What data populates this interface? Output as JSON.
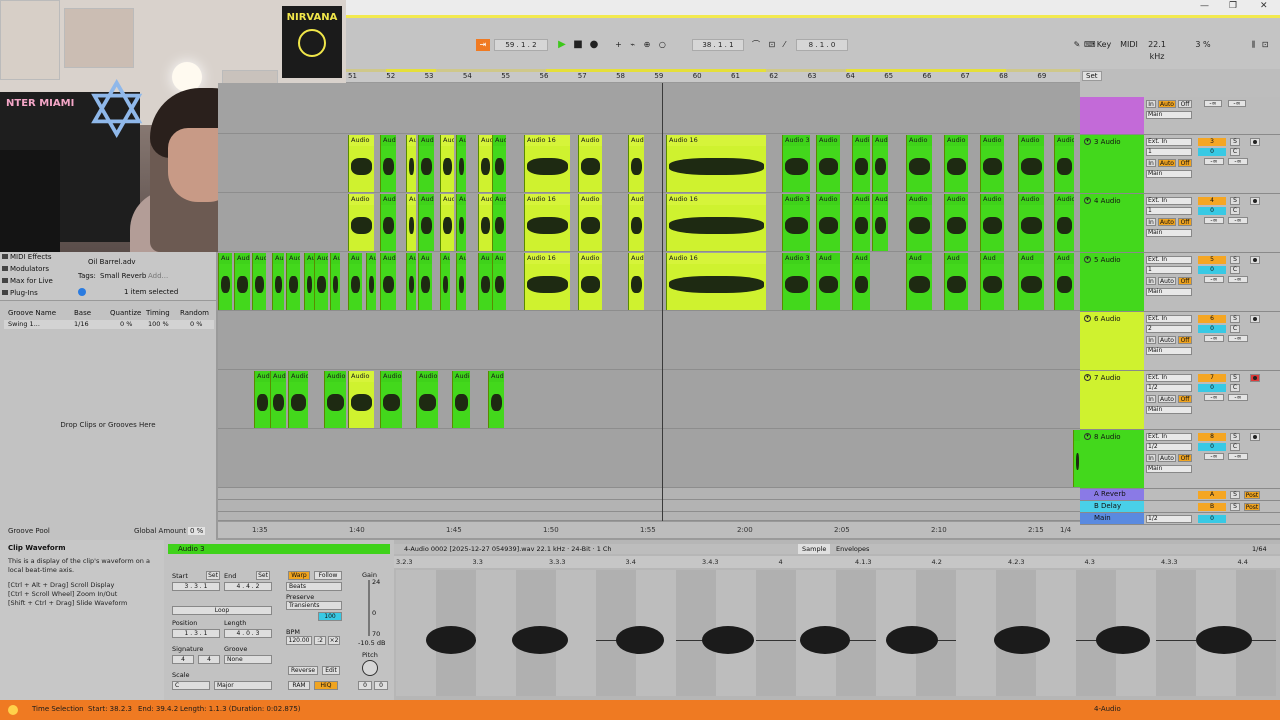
{
  "window": {
    "minimize": "—",
    "maximize": "❐",
    "close": "✕"
  },
  "transport": {
    "position": "59 . 1 . 2",
    "loop_start": "38 . 1 . 1",
    "loop_length": "8 . 1 . 0",
    "key_label": "Key",
    "midi_label": "MIDI",
    "sample_rate": "22.1 kHz",
    "cpu": "3 %"
  },
  "browser": {
    "items": [
      "MIDI Effects",
      "Modulators",
      "Max for Live",
      "Plug-Ins"
    ],
    "preset": "Oil Barrel.adv",
    "tags_label": "Tags:",
    "tag": "Small Reverb",
    "add": "Add...",
    "selection": "1 item selected"
  },
  "groove": {
    "headers": [
      "Groove Name",
      "Base",
      "Quantize",
      "Timing",
      "Random"
    ],
    "row": {
      "name": "Swing 1...",
      "base": "1/16",
      "quantize": "0 %",
      "timing": "100 %",
      "random": "0 %"
    },
    "drop_text": "Drop Clips or Grooves Here",
    "pool_label": "Groove Pool",
    "global_amount_label": "Global Amount",
    "global_amount": "0 %"
  },
  "ruler": {
    "bars": [
      "51",
      "52",
      "53",
      "54",
      "55",
      "56",
      "57",
      "58",
      "59",
      "60",
      "61",
      "62",
      "63",
      "64",
      "65",
      "66",
      "67",
      "68",
      "69"
    ],
    "set_label": "Set"
  },
  "timeline": {
    "times": [
      "1:35",
      "1:40",
      "1:45",
      "1:50",
      "1:55",
      "2:00",
      "2:05",
      "2:10",
      "2:15"
    ],
    "zoom": "1/4"
  },
  "tracks": [
    {
      "name": "",
      "number": "",
      "color": "#c36ad8"
    },
    {
      "name": "3 Audio",
      "number": "3",
      "input": "Ext. In",
      "channel": "1",
      "color": "#43d81c"
    },
    {
      "name": "4 Audio",
      "number": "4",
      "input": "Ext. In",
      "channel": "1",
      "color": "#43d81c"
    },
    {
      "name": "5 Audio",
      "number": "5",
      "input": "Ext. In",
      "channel": "1",
      "color": "#43d81c"
    },
    {
      "name": "6 Audio",
      "number": "6",
      "input": "Ext. In",
      "channel": "2",
      "color": "#cff22f"
    },
    {
      "name": "7 Audio",
      "number": "7",
      "input": "Ext. In",
      "channel": "1/2",
      "color": "#cff22f"
    },
    {
      "name": "8 Audio",
      "number": "8",
      "input": "Ext. In",
      "channel": "1/2",
      "color": "#43d81c"
    }
  ],
  "io_labels": {
    "in": "In",
    "auto": "Auto",
    "off": "Off",
    "main": "Main",
    "inf": "-∞",
    "s": "S",
    "c": "C",
    "zero": "0",
    "post": "Post"
  },
  "returns": [
    {
      "name": "A Reverb",
      "letter": "A"
    },
    {
      "name": "B Delay",
      "letter": "B"
    },
    {
      "name": "Main",
      "letter": "1/2"
    }
  ],
  "clip_labels": {
    "audio": "Audio",
    "audio16": "Audio 16",
    "audio3": "Audio 3",
    "audi": "Audi",
    "aud": "Aud",
    "au": "Au",
    "short": "Audio."
  },
  "info": {
    "title": "Clip Waveform",
    "text1": "This is a display of the clip's waveform on a local beat-time axis.",
    "text2": "[Ctrl + Alt + Drag] Scroll Display",
    "text3": "[Ctrl + Scroll Wheel] Zoom In/Out",
    "text4": "[Shift + Ctrl + Drag] Slide Waveform"
  },
  "clip": {
    "name": "Audio 3",
    "start_label": "Start",
    "end_label": "End",
    "set": "Set",
    "start": "3 . 3 . 1",
    "end": "4 . 4 . 2",
    "warp": "Warp",
    "follow": "Follow",
    "beats": "Beats",
    "preserve": "Preserve",
    "transients": "Transients",
    "gain_label": "Gain",
    "gain_top": "24",
    "gain_zero": "0",
    "gain_bot": "70",
    "gain_db": "-10.5 dB",
    "loop": "Loop",
    "position_label": "Position",
    "length_label": "Length",
    "position": "1 . 3 . 1",
    "length": "4 . 0 . 3",
    "bpm_label": "BPM",
    "bpm": "120.00",
    "half": ":2",
    "double": "×2",
    "warp_amt": "100",
    "signature_label": "Signature",
    "groove_label": "Groove",
    "sig_num": "4",
    "sig_den": "4",
    "groove_val": "None",
    "pitch_label": "Pitch",
    "pitch": "0",
    "pitch_fine": "0",
    "scale_label": "Scale",
    "scale_root": "C",
    "scale_mode": "Major",
    "reverse": "Reverse",
    "edit": "Edit",
    "ram": "RAM",
    "hiq": "HiQ"
  },
  "sample": {
    "file": "4-Audio 0002 [2025-12-27 054939].wav  22.1 kHz · 24-Bit · 1 Ch",
    "tab_sample": "Sample",
    "tab_envelopes": "Envelopes",
    "zoom": "1/64",
    "ruler": [
      "3.2.3",
      "3.3",
      "3.3.3",
      "3.4",
      "3.4.3",
      "4",
      "4.1.3",
      "4.2",
      "4.2.3",
      "4.3",
      "4.3.3",
      "4.4"
    ]
  },
  "status": {
    "mode": "Time Selection",
    "start": "Start: 38.2.3",
    "end": "End: 39.4.2",
    "length": "Length: 1.1.3 (Duration: 0:02.875)",
    "track": "4-Audio"
  }
}
